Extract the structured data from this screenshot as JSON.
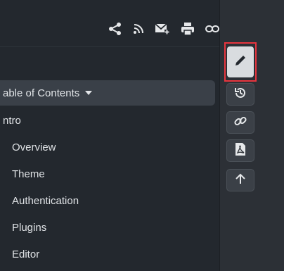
{
  "share_bar": {
    "icons": [
      "share-icon",
      "rss-icon",
      "email-icon",
      "print-icon",
      "link-icon"
    ]
  },
  "toc": {
    "header_label": "able of Contents",
    "items": [
      {
        "label": "ntro"
      },
      {
        "label": "Overview"
      },
      {
        "label": "Theme"
      },
      {
        "label": "Authentication"
      },
      {
        "label": "Plugins"
      },
      {
        "label": "Editor"
      }
    ]
  },
  "rail": {
    "tools": [
      "edit-icon",
      "history-icon",
      "link-icon",
      "pdf-icon",
      "arrow-up-icon"
    ],
    "highlight_color": "#e8353e"
  }
}
